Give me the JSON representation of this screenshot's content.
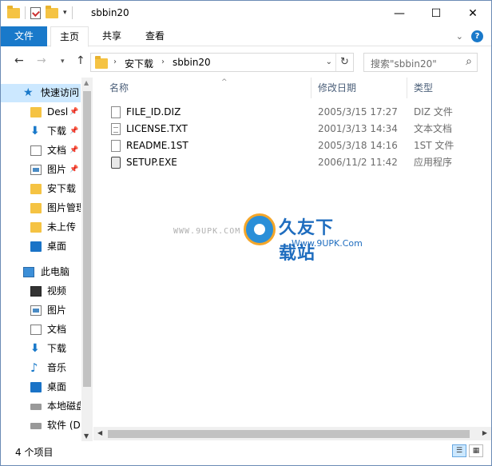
{
  "title_bar": {
    "title": "sbbin20",
    "quick_access_dropdown": "▾",
    "minimize": "—",
    "maximize": "☐",
    "close": "✕"
  },
  "ribbon": {
    "tabs": [
      "文件",
      "主页",
      "共享",
      "查看"
    ],
    "expand": "⌄",
    "help": "?"
  },
  "address": {
    "segments": [
      "安下载",
      "sbbin20"
    ],
    "chevron": "›",
    "search_placeholder": "搜索\"sbbin20\""
  },
  "nav_pane": {
    "quick_access_label": "快速访问",
    "items": [
      {
        "label": "Desl",
        "icon": "folder-icon",
        "pinned": true
      },
      {
        "label": "下载",
        "icon": "download-arrow-icon",
        "pinned": true
      },
      {
        "label": "文档",
        "icon": "document-icon",
        "pinned": true
      },
      {
        "label": "图片",
        "icon": "picture-icon",
        "pinned": true
      },
      {
        "label": "安下载",
        "icon": "folder-icon",
        "pinned": false
      },
      {
        "label": "图片管理",
        "icon": "folder-icon",
        "pinned": false
      },
      {
        "label": "未上传",
        "icon": "folder-icon",
        "pinned": false
      },
      {
        "label": "桌面",
        "icon": "desktop-icon",
        "pinned": false
      }
    ],
    "this_pc_label": "此电脑",
    "pc_items": [
      {
        "label": "视频",
        "icon": "video-icon"
      },
      {
        "label": "图片",
        "icon": "picture-icon"
      },
      {
        "label": "文档",
        "icon": "document-icon"
      },
      {
        "label": "下载",
        "icon": "download-arrow-icon"
      },
      {
        "label": "音乐",
        "icon": "music-icon"
      },
      {
        "label": "桌面",
        "icon": "desktop-icon"
      },
      {
        "label": "本地磁盘",
        "icon": "drive-icon"
      },
      {
        "label": "软件 (D",
        "icon": "drive-icon"
      }
    ]
  },
  "columns": {
    "name": "名称",
    "date": "修改日期",
    "type": "类型"
  },
  "files": [
    {
      "name": "FILE_ID.DIZ",
      "date": "2005/3/15 17:27",
      "type": "DIZ 文件",
      "icon": "file-icon"
    },
    {
      "name": "LICENSE.TXT",
      "date": "2001/3/13 14:34",
      "type": "文本文档",
      "icon": "text-file-icon"
    },
    {
      "name": "README.1ST",
      "date": "2005/3/18 14:16",
      "type": "1ST 文件",
      "icon": "file-icon"
    },
    {
      "name": "SETUP.EXE",
      "date": "2006/11/2 11:42",
      "type": "应用程序",
      "icon": "installer-icon"
    }
  ],
  "watermark": {
    "url_text": "WWW.9UPK.COM",
    "title": "久友下载站",
    "subtitle": "Www.9UPK.Com"
  },
  "status": {
    "item_count": "4 个项目"
  },
  "colors": {
    "accent": "#1979ca",
    "selection": "#cce8ff",
    "folder": "#f5c343"
  }
}
